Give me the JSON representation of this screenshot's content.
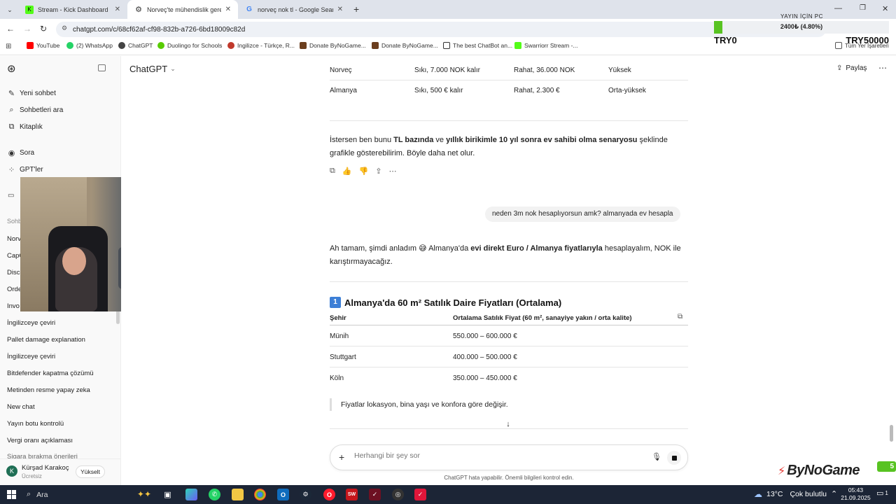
{
  "browser": {
    "tabs": [
      {
        "label": "Stream - Kick Dashboard",
        "icon": "kick-icon"
      },
      {
        "label": "Norveç'te mühendislik gereksin",
        "icon": "chatgpt-icon"
      },
      {
        "label": "norveç nok tl - Google Search",
        "icon": "google-icon"
      }
    ],
    "url": "chatgpt.com/c/68cf62af-cf98-832b-a726-6bd18009c82d",
    "bookmarks": [
      "YouTube",
      "(2) WhatsApp",
      "ChatGPT",
      "Duolingo for Schools",
      "Ingilizce - Türkçe, R...",
      "Donate ByNoGame...",
      "Donate ByNoGame...",
      "The best ChatBot an...",
      "Swarriorr Stream -..."
    ],
    "bookmarks_folder": "Tüm Yer İşaretleri"
  },
  "overlay": {
    "title": "YAYIN İÇİN PC",
    "progress_text": "2400₺ (4.80%)",
    "progress_fraction": 0.048,
    "left_amount": "TRY0",
    "right_amount": "TRY50000"
  },
  "sidebar": {
    "nav": [
      "Yeni sohbet",
      "Sohbetleri ara",
      "Kitaplık",
      "Sora",
      "GPT'ler"
    ],
    "section_partial": "Sohb",
    "partial_items": [
      "Norv",
      "CapC",
      "Disc",
      "Orde",
      "Invo"
    ],
    "conversations": [
      "İngilizceye çeviri",
      "Pallet damage explanation",
      "İngilizceye çeviri",
      "Bitdefender kapatma çözümü",
      "Metinden resme yapay zeka",
      "New chat",
      "Yayın botu kontrolü",
      "Vergi oranı açıklaması",
      "Sigara bırakma önerileri"
    ],
    "user_name": "Kürşad Karakoç",
    "user_plan": "Ücretsiz",
    "user_initial": "K",
    "upgrade_label": "Yükselt"
  },
  "header": {
    "model": "ChatGPT",
    "share_label": "Paylaş"
  },
  "chat": {
    "top_table": [
      [
        "Norveç",
        "Sıkı, 7.000 NOK kalır",
        "Rahat, 36.000 NOK",
        "Yüksek"
      ],
      [
        "Almanya",
        "Sıkı, 500 € kalır",
        "Rahat, 2.300 €",
        "Orta-yüksek"
      ]
    ],
    "p1": {
      "a": "İstersen ben bunu ",
      "b": "TL bazında",
      "c": " ve ",
      "d": "yıllık birikimle 10 yıl sonra ev sahibi olma senaryosu",
      "e": " şeklinde grafikle gösterebilirim. Böyle daha net olur."
    },
    "user_msg": "neden 3m nok hesaplıyorsun amk? almanyada ev hesapla",
    "p2": {
      "a": "Ah tamam, şimdi anladım 😅 Almanya'da ",
      "b": "evi direkt Euro / Almanya fiyatlarıyla",
      "c": " hesaplayalım, NOK ile karıştırmayacağız."
    },
    "heading_num": "1",
    "heading": "Almanya'da 60 m² Satılık Daire Fiyatları (Ortalama)",
    "table_headers": [
      "Şehir",
      "Ortalama Satılık Fiyat (60 m², sanayiye yakın / orta kalite)"
    ],
    "table_rows": [
      [
        "Münih",
        "550.000 – 600.000 €"
      ],
      [
        "Stuttgart",
        "400.000 – 500.000 €"
      ],
      [
        "Köln",
        "350.000 – 450.000 €"
      ]
    ],
    "quote": "Fiyatlar lokasyon, bina yaşı ve konfora göre değişir.",
    "input_placeholder": "Herhangi bir şey sor",
    "disclaimer": "ChatGPT hata yapabilir. Önemli bilgileri kontrol edin."
  },
  "brand": {
    "logo": "ByNoGame",
    "badge": "5"
  },
  "taskbar": {
    "search_label": "Ara",
    "weather": "13°C",
    "weather_desc": "Çok bulutlu",
    "time": "05:43",
    "date": "21.09.2025",
    "notif_count": "1"
  },
  "colors": {
    "accent": "#58c322",
    "ui_bg": "#dfe3eb",
    "taskbar": "#1c2536"
  }
}
